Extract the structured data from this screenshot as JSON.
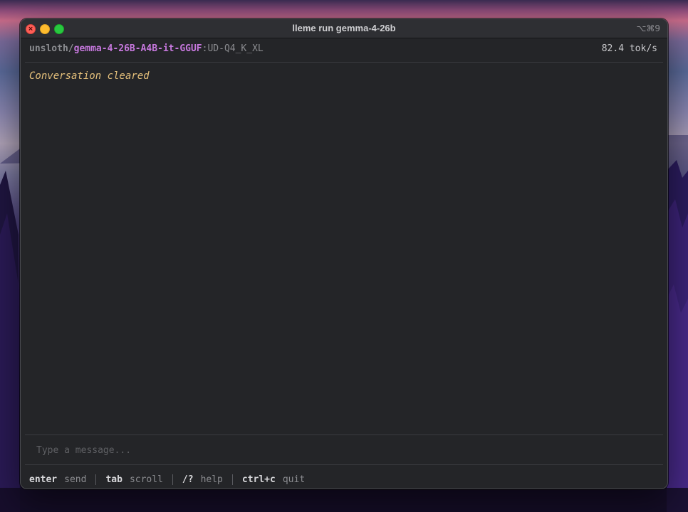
{
  "window": {
    "title": "lleme run gemma-4-26b",
    "shortcut": "⌥⌘9"
  },
  "status_bar": {
    "model_owner": "unsloth/",
    "model_name": "gemma-4-26B-A4B-it-GGUF",
    "model_quant": ":UD-Q4_K_XL",
    "throughput": "82.4 tok/s"
  },
  "messages": [
    {
      "kind": "system",
      "text": "Conversation cleared"
    }
  ],
  "input": {
    "value": "",
    "placeholder": "Type a message..."
  },
  "footer_hints": [
    {
      "key": "enter",
      "desc": "send"
    },
    {
      "key": "tab",
      "desc": "scroll"
    },
    {
      "key": "/?",
      "desc": "help"
    },
    {
      "key": "ctrl+c",
      "desc": "quit"
    }
  ],
  "colors": {
    "model_name": "#c678dd",
    "system_message": "#e5c07b",
    "terminal_bg": "#242528"
  }
}
